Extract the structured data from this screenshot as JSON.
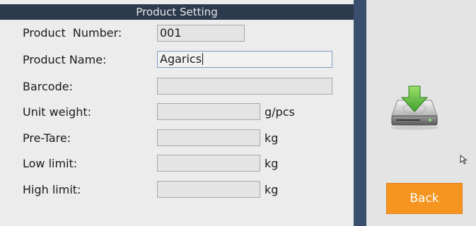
{
  "title": "Product Setting",
  "fields": {
    "product_number": {
      "label": "Product  Number:",
      "value": "001"
    },
    "product_name": {
      "label": "Product Name:",
      "value": "Agarics"
    },
    "barcode": {
      "label": "Barcode:",
      "value": ""
    },
    "unit_weight": {
      "label": "Unit weight:",
      "value": "",
      "unit": "g/pcs"
    },
    "pre_tare": {
      "label": "Pre-Tare:",
      "value": "",
      "unit": "kg"
    },
    "low_limit": {
      "label": "Low limit:",
      "value": "",
      "unit": "kg"
    },
    "high_limit": {
      "label": "High limit:",
      "value": "",
      "unit": "kg"
    }
  },
  "actions": {
    "save_icon": "save-download-icon",
    "back_label": "Back"
  },
  "colors": {
    "title_bar": "#2c3a4e",
    "divider": "#3a4f6e",
    "back_button": "#f5941e",
    "icon_arrow": "#6cc24a"
  }
}
